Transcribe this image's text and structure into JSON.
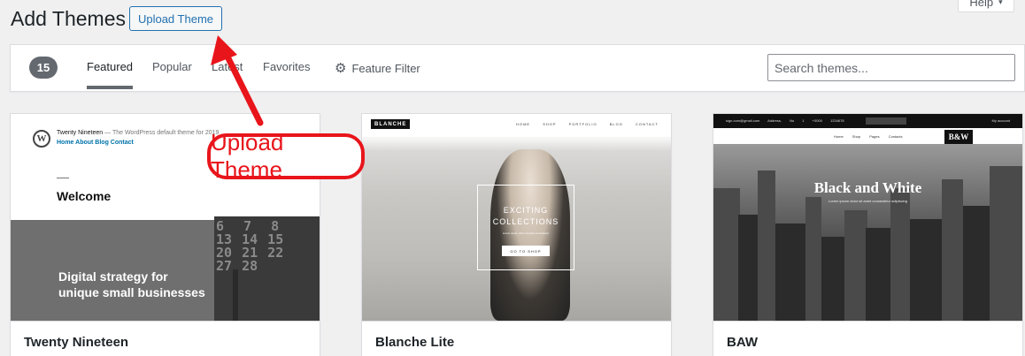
{
  "header": {
    "title": "Add Themes",
    "upload_button": "Upload Theme",
    "help_tab": "Help"
  },
  "filter_bar": {
    "count": "15",
    "tabs": [
      {
        "label": "Featured",
        "active": true
      },
      {
        "label": "Popular",
        "active": false
      },
      {
        "label": "Latest",
        "active": false
      },
      {
        "label": "Favorites",
        "active": false
      }
    ],
    "feature_filter": "Feature Filter",
    "search_placeholder": "Search themes..."
  },
  "themes": [
    {
      "name": "Twenty Nineteen",
      "preview": {
        "site_title": "Twenty Nineteen",
        "tagline": "The WordPress default theme for 2019",
        "nav": "Home  About  Blog  Contact",
        "welcome": "Welcome",
        "banner": "Digital strategy for\nunique small businesses",
        "calendar": "6  7  8\n13 14 15\n20 21 22\n27 28"
      }
    },
    {
      "name": "Blanche Lite",
      "preview": {
        "logo": "BLANCHE",
        "menu": "HOME  SHOP  PORTFOLIO  BLOG  CONTACT",
        "hero_title": "EXCITING\nCOLLECTIONS",
        "hero_sub": "Lorem ipsum dolor sit amet consectetur",
        "hero_button": "GO TO SHOP"
      }
    },
    {
      "name": "BAW",
      "preview": {
        "top_info": "sign.com@gmail.com  Address, No 1  +0000 1234678",
        "account": "My account",
        "nav": "Home  Shop  Pages  Contacts",
        "logo": "B&W",
        "hero_title": "Black and White",
        "hero_sub": "Lorem ipsum dolor sit amet consectetur adipiscing"
      }
    }
  ],
  "annotation": {
    "label": "Upload Theme",
    "color": "#e8151b"
  },
  "colors": {
    "accent": "#2271b1",
    "background": "#f0f0f1",
    "count_badge": "#646970"
  }
}
